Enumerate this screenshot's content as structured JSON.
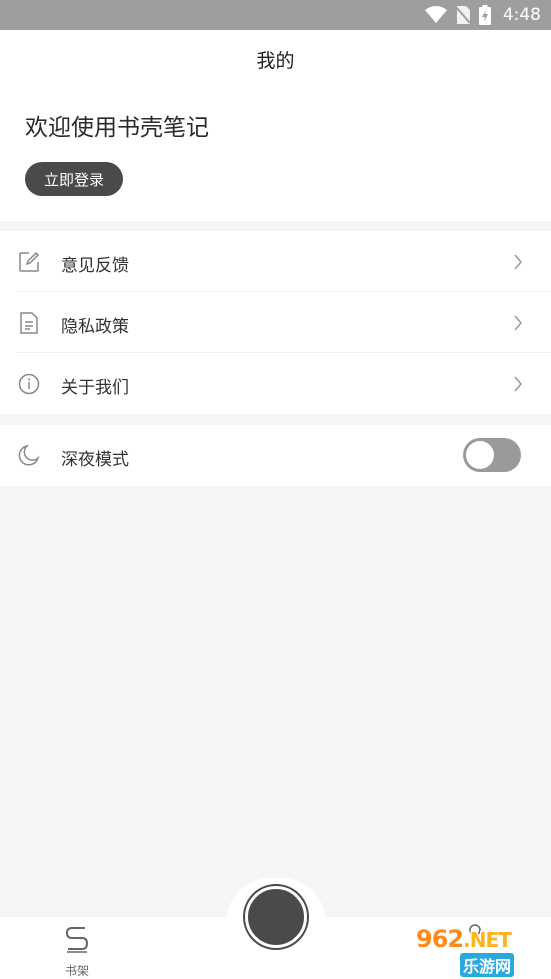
{
  "status_bar": {
    "time": "4:48",
    "icons": [
      "wifi-icon",
      "no-sim-icon",
      "battery-icon"
    ]
  },
  "header": {
    "title": "我的"
  },
  "profile": {
    "welcome": "欢迎使用书壳笔记",
    "login_button": "立即登录"
  },
  "menu": {
    "items": [
      {
        "label": "意见反馈",
        "icon": "edit-icon"
      },
      {
        "label": "隐私政策",
        "icon": "document-icon"
      },
      {
        "label": "关于我们",
        "icon": "info-icon"
      }
    ]
  },
  "night_mode": {
    "label": "深夜模式",
    "enabled": false,
    "icon": "moon-icon"
  },
  "tabbar": {
    "shelf_label": "书架",
    "center_icon": "record-button",
    "mine_icon": "person-icon"
  },
  "watermark": {
    "main": "962",
    "suffix": ".NET",
    "sub": "乐游网"
  },
  "colors": {
    "accent": "#4a4a4a",
    "background": "#f5f5f5",
    "statusbar": "#9e9e9e"
  }
}
